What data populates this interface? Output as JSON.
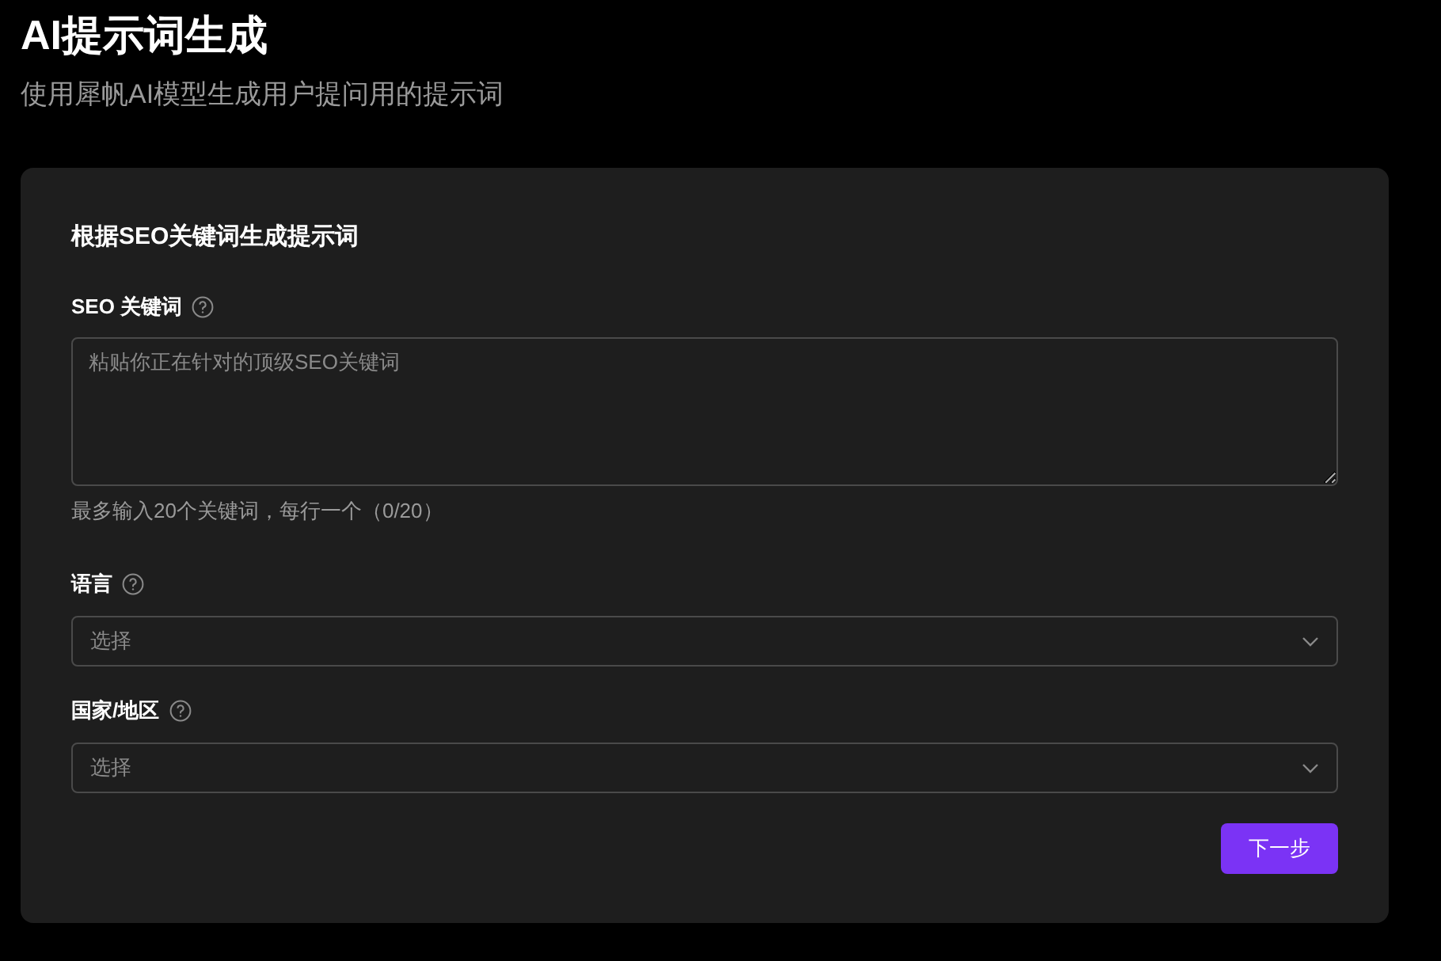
{
  "page": {
    "title": "AI提示词生成",
    "subtitle": "使用犀帆AI模型生成用户提问用的提示词"
  },
  "card": {
    "heading": "根据SEO关键词生成提示词",
    "fields": [
      {
        "kind": "textarea",
        "label": "SEO 关键词",
        "placeholder": "粘贴你正在针对的顶级SEO关键词",
        "hint": "最多输入20个关键词，每行一个（0/20）"
      },
      {
        "kind": "select",
        "label": "语言",
        "placeholder": "选择"
      },
      {
        "kind": "select",
        "label": "国家/地区",
        "placeholder": "选择"
      }
    ],
    "button": "下一步"
  }
}
